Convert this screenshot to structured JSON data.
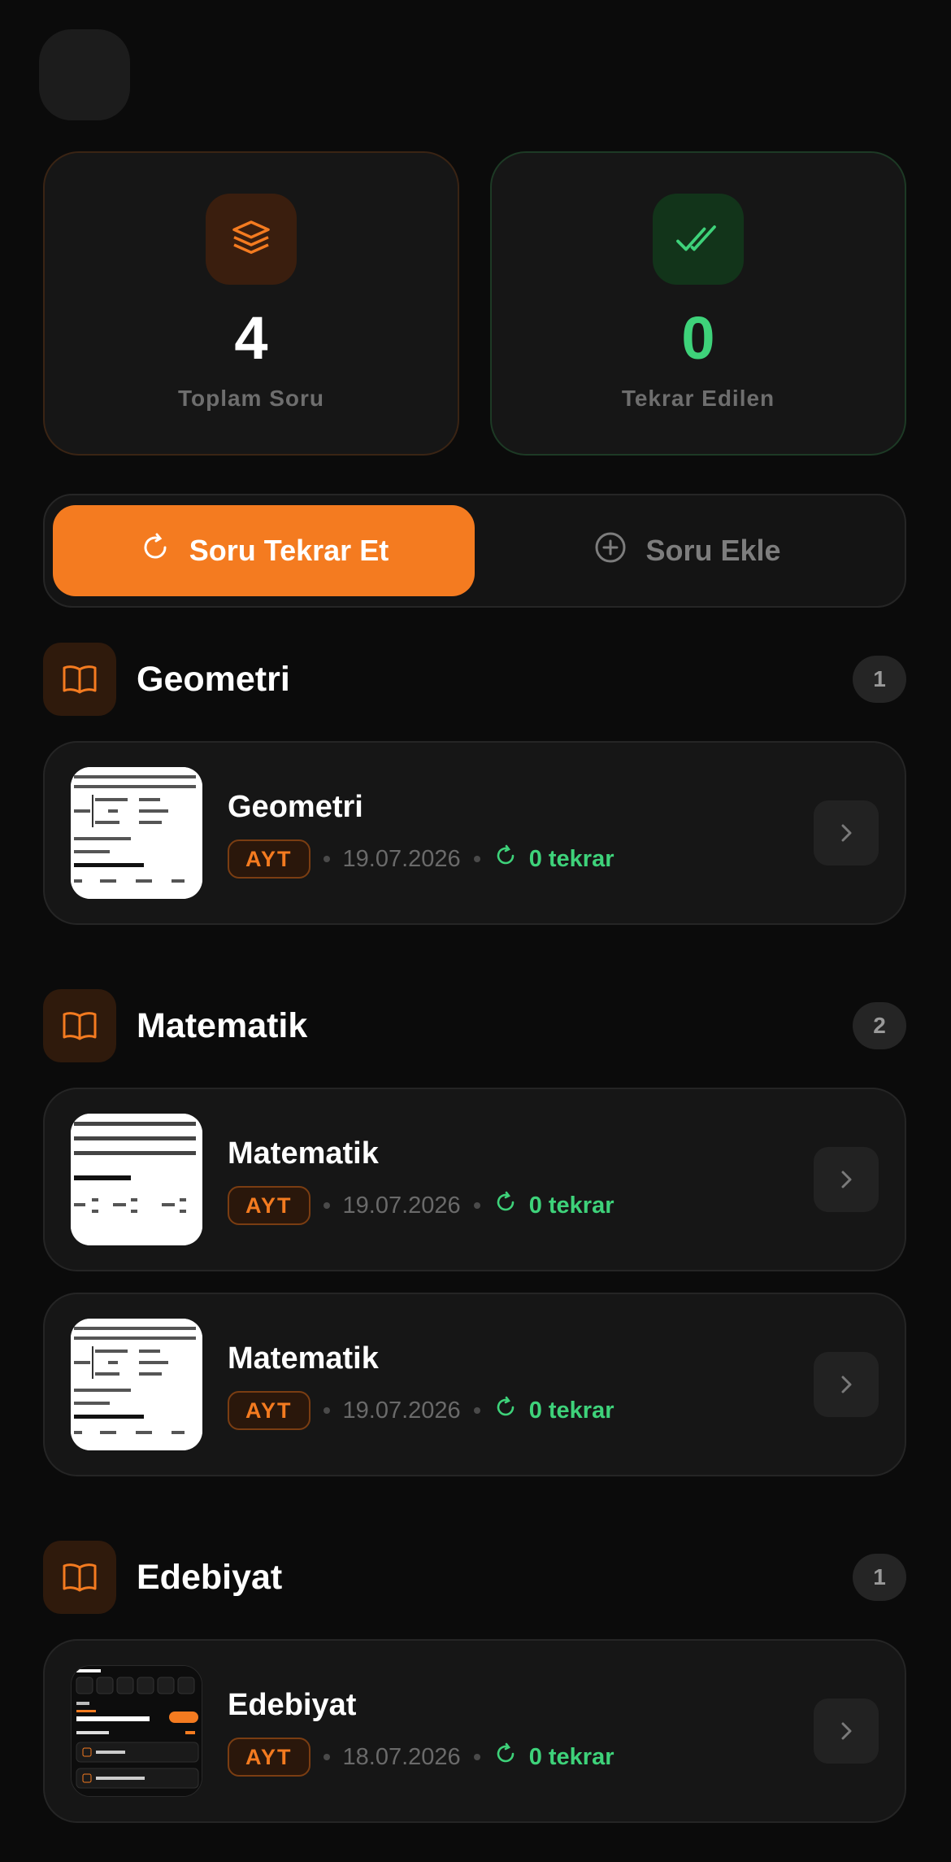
{
  "stats": {
    "total": {
      "value": "4",
      "label": "Toplam Soru",
      "icon": "layers-icon"
    },
    "reviewed": {
      "value": "0",
      "label": "Tekrar Edilen",
      "icon": "double-check-icon"
    }
  },
  "actions": {
    "review_label": "Soru Tekrar Et",
    "add_label": "Soru Ekle"
  },
  "sections": [
    {
      "title": "Geometri",
      "count": "1",
      "items": [
        {
          "title": "Geometri",
          "tag": "AYT",
          "date": "19.07.2026",
          "reviews": "0 tekrar"
        }
      ]
    },
    {
      "title": "Matematik",
      "count": "2",
      "items": [
        {
          "title": "Matematik",
          "tag": "AYT",
          "date": "19.07.2026",
          "reviews": "0 tekrar"
        },
        {
          "title": "Matematik",
          "tag": "AYT",
          "date": "19.07.2026",
          "reviews": "0 tekrar"
        }
      ]
    },
    {
      "title": "Edebiyat",
      "count": "1",
      "items": [
        {
          "title": "Edebiyat",
          "tag": "AYT",
          "date": "18.07.2026",
          "reviews": "0 tekrar"
        }
      ]
    }
  ],
  "colors": {
    "accent": "#f47b20",
    "success": "#3ed27a",
    "background": "#0b0b0b",
    "card": "#161616"
  }
}
